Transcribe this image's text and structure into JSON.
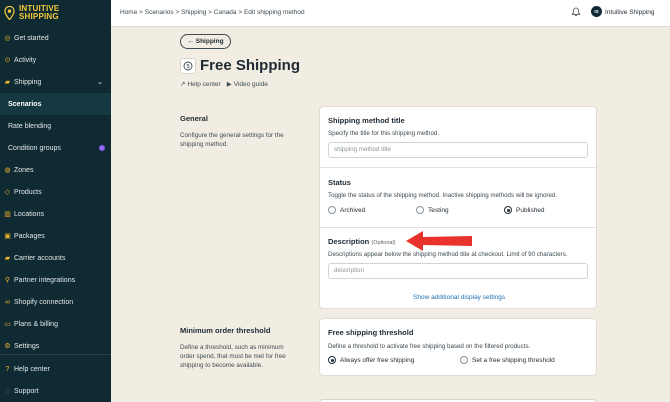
{
  "brand": {
    "line1": "INTUITIVE",
    "line2": "SHIPPING"
  },
  "sidebar": {
    "items": [
      {
        "label": "Get started",
        "icon": "target-icon"
      },
      {
        "label": "Activity",
        "icon": "activity-icon"
      },
      {
        "label": "Shipping",
        "icon": "truck-icon"
      },
      {
        "label": "Scenarios",
        "icon": ""
      },
      {
        "label": "Rate blending",
        "icon": ""
      },
      {
        "label": "Condition groups",
        "icon": ""
      },
      {
        "label": "Zones",
        "icon": "zones-icon"
      },
      {
        "label": "Products",
        "icon": "tag-icon"
      },
      {
        "label": "Locations",
        "icon": "building-icon"
      },
      {
        "label": "Packages",
        "icon": "package-icon"
      },
      {
        "label": "Carrier accounts",
        "icon": "truck-icon"
      },
      {
        "label": "Partner integrations",
        "icon": "plug-icon"
      },
      {
        "label": "Shopify connection",
        "icon": "link-icon"
      },
      {
        "label": "Plans & billing",
        "icon": "card-icon"
      },
      {
        "label": "Settings",
        "icon": "gear-icon"
      }
    ],
    "bottom": [
      {
        "label": "Help center",
        "icon": "help-icon"
      },
      {
        "label": "Support",
        "icon": "support-icon"
      }
    ]
  },
  "topbar": {
    "breadcrumb": "Home  >  Scenarios  >  Shipping  >  Canada  >  Edit shipping method",
    "avatar_initials": "IS",
    "account_name": "Intuitive Shipping"
  },
  "header": {
    "back_label": "← Shipping",
    "title": "Free Shipping",
    "help_link": "Help center",
    "video_link": "Video guide"
  },
  "general": {
    "title": "General",
    "description": "Configure the general settings for the shipping method.",
    "method_title_label": "Shipping method title",
    "method_title_desc": "Specify the title for this shipping method.",
    "method_title_placeholder": "shipping method title",
    "status_label": "Status",
    "status_desc": "Toggle the status of the shipping method. Inactive shipping methods will be ignored.",
    "status_options": [
      "Archived",
      "Testing",
      "Published"
    ],
    "status_selected": "Published",
    "description_label": "Description",
    "description_optional": "(Optional)",
    "description_desc": "Descriptions appear below the shipping method title at checkout. Limit of 90 characters.",
    "description_placeholder": "description",
    "show_more": "Show additional display settings"
  },
  "minimum": {
    "title": "Minimum order threshold",
    "description": "Define a threshold, such as minimum order spend, that must be met for free shipping to become available.",
    "card_title": "Free shipping threshold",
    "card_desc": "Define a threshold to activate free shipping based on the filtered products.",
    "options": [
      "Always offer free shipping",
      "Set a free shipping threshold"
    ],
    "selected": "Always offer free shipping"
  },
  "colors": {
    "sidebar": "#0f2a32",
    "accent": "#f3c83a",
    "arrow": "#e8322b",
    "link": "#1f6fb2"
  }
}
